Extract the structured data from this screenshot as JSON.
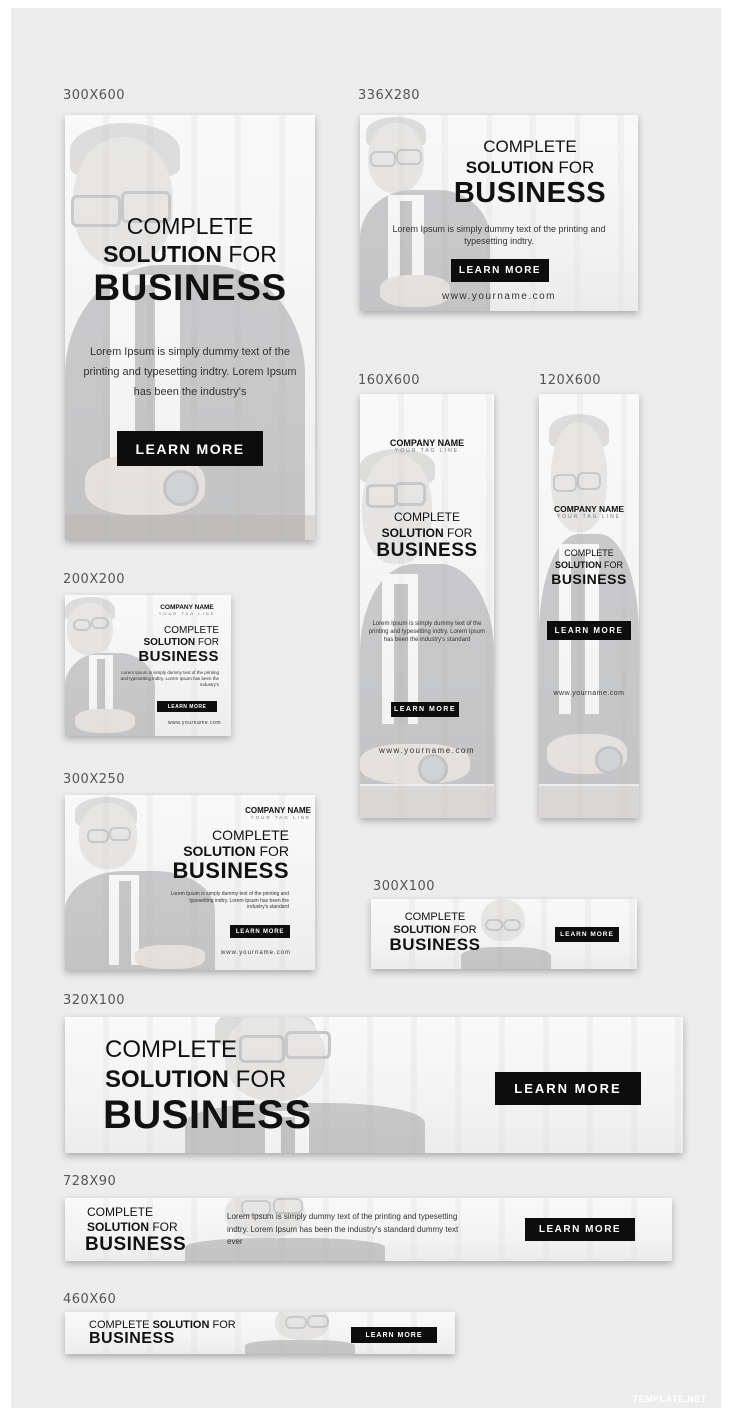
{
  "colors": {
    "background": "#ececec",
    "button": "#0d0d0d",
    "text": "#111111"
  },
  "headline": {
    "line1": "COMPLETE",
    "line2_bold": "SOLUTION",
    "line2_thin": "FOR",
    "line3": "BUSINESS",
    "inline": "COMPLETE"
  },
  "button_label": "LEARN MORE",
  "url": "www.yourname.com",
  "company_name": "COMPANY NAME",
  "tagline": "YOUR TAG LINE",
  "body": {
    "long": "Lorem Ipsum is simply dummy text of the printing and typesetting indtry. Lorem Ipsum has been the industry's",
    "short": "Lorem Ipsum is simply dummy text of the printing and typesetting indtry.",
    "standard": "Lorem Ipsum is simply dummy text of the printing and typesetting indtry. Lorem Ipsum has been the industry's standard",
    "standard_dummy": "Lorem Ipsum is simply dummy text of the printing and typesetting indtry. Lorem Ipsum has been the industry's standard dummy text ever",
    "square": "Lorem Ipsum is simply dummy text of the printing and typesetting indtry. Lorem Ipsum has been the industry's"
  },
  "sizes": {
    "s300x600": "300X600",
    "s336x280": "336X280",
    "s160x600": "160X600",
    "s120x600": "120X600",
    "s200x200": "200X200",
    "s300x250": "300X250",
    "s300x100": "300X100",
    "s320x100": "320X100",
    "s728x90": "728X90",
    "s460x60": "460X60"
  },
  "watermark": "TEMPLATE.NET"
}
